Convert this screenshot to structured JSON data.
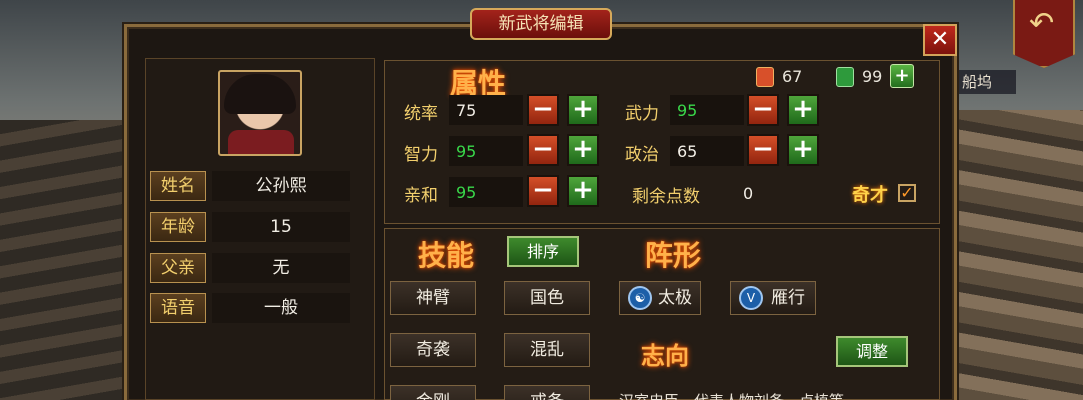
{
  "window": {
    "title": "新武将编辑"
  },
  "background": {
    "place_label": "船坞"
  },
  "profile": {
    "rows": [
      {
        "label": "姓名",
        "value": "公孙熙"
      },
      {
        "label": "年龄",
        "value": "15"
      },
      {
        "label": "父亲",
        "value": "无"
      },
      {
        "label": "语音",
        "value": "一般"
      }
    ]
  },
  "attributes": {
    "title": "属性",
    "currency_a": "67",
    "currency_b": "99",
    "stats": [
      {
        "label": "统率",
        "value": "75",
        "color": "white"
      },
      {
        "label": "武力",
        "value": "95",
        "color": "green"
      },
      {
        "label": "智力",
        "value": "95",
        "color": "green"
      },
      {
        "label": "政治",
        "value": "65",
        "color": "white"
      },
      {
        "label": "亲和",
        "value": "95",
        "color": "green"
      }
    ],
    "remaining_label": "剩余点数",
    "remaining_value": "0",
    "qicai_label": "奇才",
    "minus": "−",
    "plus": "+"
  },
  "skills": {
    "title": "技能",
    "sort_label": "排序",
    "items": [
      "神臂",
      "国色",
      "奇袭",
      "混乱",
      "金刚",
      "戒备"
    ]
  },
  "formation": {
    "title": "阵形",
    "items": [
      {
        "label": "太极",
        "icon": "taiji-icon"
      },
      {
        "label": "雁行",
        "icon": "yanxing-icon"
      }
    ]
  },
  "ambition": {
    "title": "志向",
    "adjust_label": "调整",
    "text": "汉室忠臣，代表人物刘备、卢植等"
  },
  "colors": {
    "accent": "#ffb14a",
    "frame": "#8a6b3c",
    "green": "#39d84a",
    "title_red": "#a3231b"
  }
}
